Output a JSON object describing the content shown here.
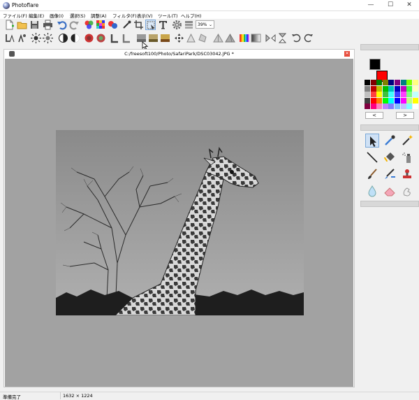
{
  "window": {
    "title": "Photoflare",
    "minimize_glyph": "—",
    "maximize_glyph": "☐",
    "close_glyph": "✕"
  },
  "menu": [
    {
      "id": "file",
      "label": "ファイル(F)"
    },
    {
      "id": "edit",
      "label": "編集(E)"
    },
    {
      "id": "image",
      "label": "画像(I)"
    },
    {
      "id": "select",
      "label": "選択(S)"
    },
    {
      "id": "adjust",
      "label": "調整(A)"
    },
    {
      "id": "filter",
      "label": "フィルタ(F)"
    },
    {
      "id": "view",
      "label": "表示(V)"
    },
    {
      "id": "tools",
      "label": "ツール(T)"
    },
    {
      "id": "help",
      "label": "ヘルプ(H)"
    }
  ],
  "toolbar": {
    "zoom_value": "39%",
    "zoom_arrow": "⌄"
  },
  "document": {
    "title": "C:/freesoft100/Photo/SafariPark/DSC03042.JPG *",
    "close_glyph": "✕"
  },
  "palette": {
    "foreground": "#000000",
    "background": "#ff0000",
    "prev_glyph": "<",
    "next_glyph": ">",
    "colors": [
      "#000000",
      "#800000",
      "#008000",
      "#808000",
      "#000080",
      "#800080",
      "#008080",
      "#80ff00",
      "#ffff80",
      "#808080",
      "#c00000",
      "#c0c000",
      "#00c000",
      "#00c0c0",
      "#0000c0",
      "#c000c0",
      "#40ff40",
      "#ffffc0",
      "#c0c0c0",
      "#ff4040",
      "#ffff00",
      "#40c040",
      "#40ffff",
      "#4040ff",
      "#ff40ff",
      "#80ff80",
      "#c0ffff",
      "#404040",
      "#ff0000",
      "#ff8000",
      "#00ff00",
      "#00ffff",
      "#0000ff",
      "#ff00ff",
      "#c0ff80",
      "#ffff00",
      "#800040",
      "#ff0080",
      "#ff80c0",
      "#c080ff",
      "#8080ff",
      "#80c0ff",
      "#c0c0ff",
      "#80ffff",
      "#ffffff"
    ]
  },
  "status": {
    "message": "準備完了",
    "dimensions": "1632 × 1224"
  }
}
